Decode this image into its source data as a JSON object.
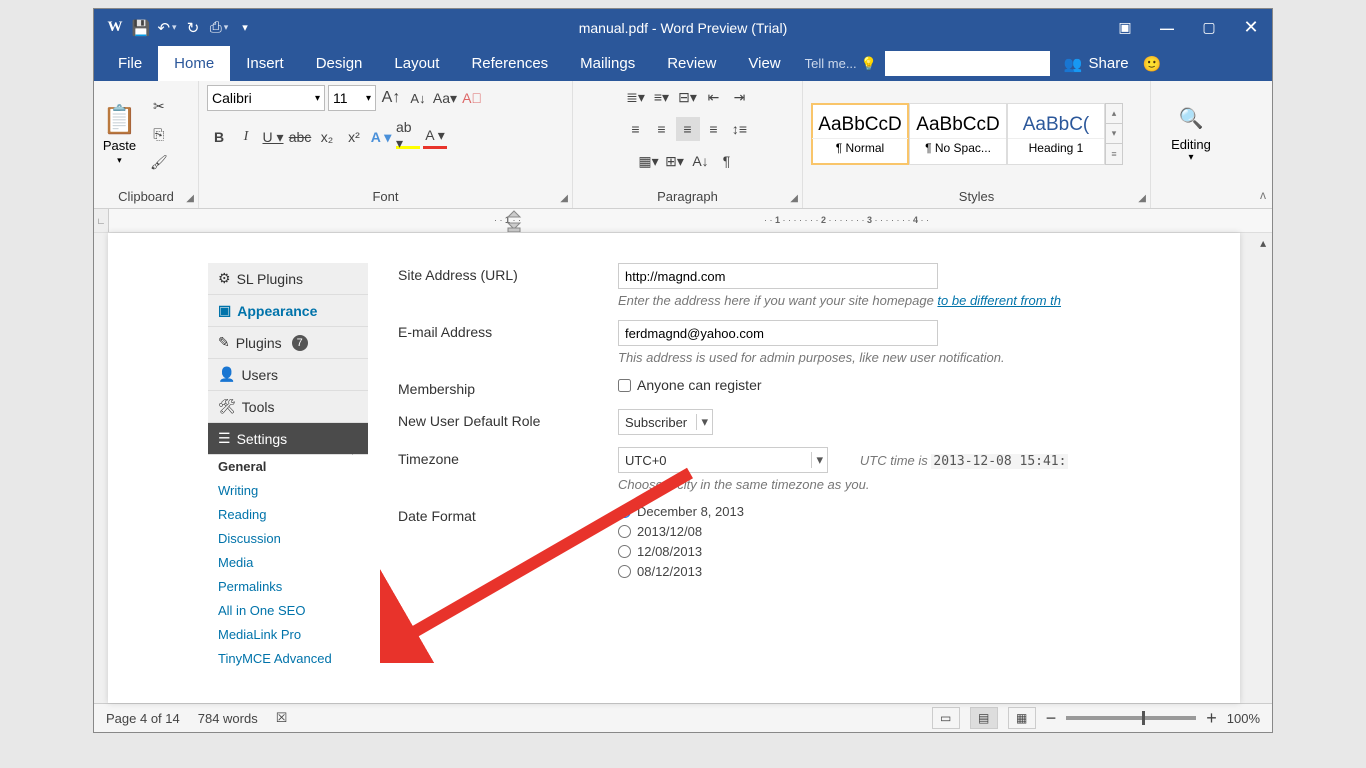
{
  "colors": {
    "word_blue": "#2b579a",
    "accent_arrow": "#e8332b"
  },
  "titlebar": {
    "title": "manual.pdf - Word Preview (Trial)"
  },
  "tabs": [
    "File",
    "Home",
    "Insert",
    "Design",
    "Layout",
    "References",
    "Mailings",
    "Review",
    "View"
  ],
  "active_tab": "Home",
  "tell_me": "Tell me...",
  "share_label": "Share",
  "ribbon": {
    "clipboard": {
      "paste": "Paste",
      "label": "Clipboard"
    },
    "font": {
      "name": "Calibri",
      "size": "11",
      "label": "Font"
    },
    "paragraph": {
      "label": "Paragraph"
    },
    "styles": {
      "label": "Styles",
      "items": [
        {
          "preview": "AaBbCcD",
          "label": "¶ Normal"
        },
        {
          "preview": "AaBbCcD",
          "label": "¶ No Spac..."
        },
        {
          "preview": "AaBbC(",
          "label": "Heading 1"
        }
      ]
    },
    "editing": {
      "label": "Editing"
    }
  },
  "ruler_marks": [
    "1",
    "1",
    "2",
    "3",
    "4"
  ],
  "wp": {
    "sidebar": [
      {
        "icon": "⚙",
        "label": "SL Plugins"
      },
      {
        "icon": "▣",
        "label": "Appearance"
      },
      {
        "icon": "✎",
        "label": "Plugins",
        "badge": "7"
      },
      {
        "icon": "👤",
        "label": "Users"
      },
      {
        "icon": "🛠",
        "label": "Tools"
      },
      {
        "icon": "☰",
        "label": "Settings",
        "current": true
      }
    ],
    "subitems": [
      "General",
      "Writing",
      "Reading",
      "Discussion",
      "Media",
      "Permalinks",
      "All in One SEO",
      "MediaLink Pro",
      "TinyMCE Advanced"
    ],
    "form": {
      "site_url_label": "Site Address (URL)",
      "site_url_value": "http://magnd.com",
      "site_url_help_pre": "Enter the address here if you want your site homepage ",
      "site_url_help_link": "to be different from th",
      "email_label": "E-mail Address",
      "email_value": "ferdmagnd@yahoo.com",
      "email_help": "This address is used for admin purposes, like new user notification.",
      "membership_label": "Membership",
      "membership_checkbox": "Anyone can register",
      "role_label": "New User Default Role",
      "role_value": "Subscriber",
      "tz_label": "Timezone",
      "tz_value": "UTC+0",
      "tz_utc_prefix": "UTC time is",
      "tz_utc_value": "2013-12-08 15:41:",
      "tz_help": "Choose a city in the same timezone as you.",
      "date_label": "Date Format",
      "date_options": [
        "December 8, 2013",
        "2013/12/08",
        "12/08/2013",
        "08/12/2013"
      ]
    }
  },
  "statusbar": {
    "page": "Page 4 of 14",
    "words": "784 words",
    "zoom": "100%"
  }
}
